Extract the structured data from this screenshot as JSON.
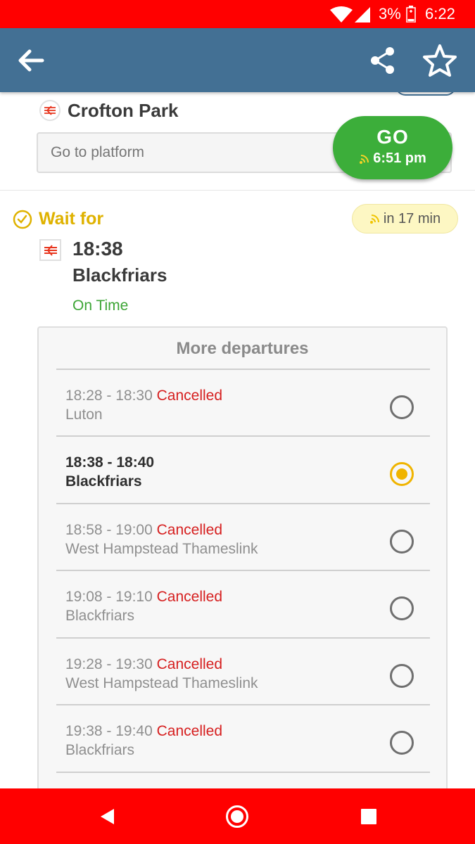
{
  "status_bar": {
    "battery_percent": "3%",
    "time": "6:22",
    "icons": [
      "wifi-icon",
      "cell-signal-icon",
      "battery-charging-icon"
    ]
  },
  "app_bar": {
    "icons": [
      "back-arrow-icon",
      "share-icon",
      "star-outline-icon"
    ],
    "color": "#437094"
  },
  "origin": {
    "station": "Crofton Park",
    "icon": "national-rail-icon"
  },
  "platform_input": {
    "placeholder": "Go to platform"
  },
  "go_button": {
    "label": "GO",
    "time": "6:51 pm",
    "icon": "live-signal-icon",
    "color": "#3cae3a"
  },
  "wait": {
    "label": "Wait for",
    "countdown": "in 17 min",
    "icon": "clock-check-icon"
  },
  "departure": {
    "time": "18:38",
    "destination": "Blackfriars",
    "status": "On Time"
  },
  "more_departures": {
    "title": "More departures",
    "rows": [
      {
        "times": "18:28 - 18:30",
        "status": "Cancelled",
        "destination": "Luton",
        "selected": false
      },
      {
        "times": "18:38 - 18:40",
        "status": "",
        "destination": "Blackfriars",
        "selected": true
      },
      {
        "times": "18:58 - 19:00",
        "status": "Cancelled",
        "destination": "West Hampstead Thameslink",
        "selected": false
      },
      {
        "times": "19:08 - 19:10",
        "status": "Cancelled",
        "destination": "Blackfriars",
        "selected": false
      },
      {
        "times": "19:28 - 19:30",
        "status": "Cancelled",
        "destination": "West Hampstead Thameslink",
        "selected": false
      },
      {
        "times": "19:38 - 19:40",
        "status": "Cancelled",
        "destination": "Blackfriars",
        "selected": false
      }
    ]
  },
  "colors": {
    "status_bar": "#ff0000",
    "wait_accent": "#dfb200",
    "cancelled": "#d61f1f",
    "on_time": "#3ca535",
    "selected_radio": "#f0b400"
  },
  "nav_bar": {
    "icons": [
      "nav-back-icon",
      "nav-home-icon",
      "nav-recents-icon"
    ]
  }
}
